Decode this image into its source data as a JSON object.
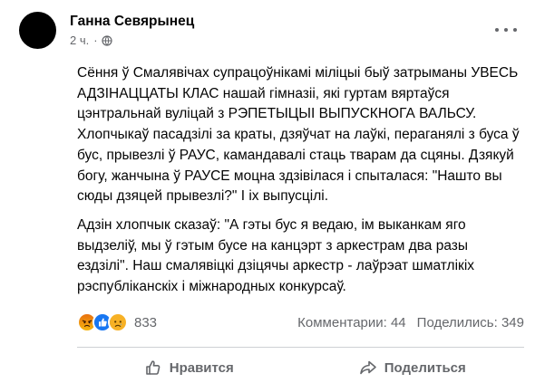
{
  "post": {
    "author": "Ганна Севярынец",
    "time": "2 ч.",
    "separator": "·",
    "privacy_icon": "globe-icon",
    "more_icon": "more-options-icon",
    "body": {
      "paragraph1": [
        "Сёння ў Смалявічах супрацоўнікамі міліцыі быў затрыманы УВЕСЬ",
        "АДЗІНАЦЦАТЫ КЛАС нашай гімназіі, які гуртам вяртаўся",
        "цэнтральнай вуліцай з РЭПЕТЫЦЫІ ВЫПУСКНОГА ВАЛЬСУ.",
        "Хлопчыкаў пасадзілі за краты, дзяўчат на лаўкі, пераганялі з буса ў",
        "бус, прывезлі ў РАУС, камандавалі стаць тварам да сцяны. Дзякуй",
        "богу, жанчына ў РАУСЕ моцна здзівілася і спыталася: \"Нашто вы",
        "сюды дзяцей прывезлі?\" І іх выпусцілі."
      ],
      "paragraph2": [
        "Адзін хлопчык сказаў: \"А гэты бус я ведаю, ім выканкам яго",
        "выдзеліў, мы ў гэтым бусе на канцэрт з аркестрам два разы",
        "ездзілі\". Наш смалявіцкі дзіцячы аркестр - лаўрэат шматлікіх",
        "рэспубліканскіх і міжнародных конкурсаў."
      ]
    },
    "reactions": {
      "icons": [
        "angry-reaction-icon",
        "like-reaction-icon",
        "sad-reaction-icon"
      ],
      "count": "833",
      "comments": "Комментарии: 44",
      "shares": "Поделились: 349"
    },
    "actions": {
      "like_label": "Нравится",
      "share_label": "Поделиться",
      "like_icon": "thumbs-up-icon",
      "share_icon": "share-arrow-icon"
    },
    "colors": {
      "text": "#050505",
      "secondary": "#65676b",
      "like_blue": "#1877f2",
      "angry_orange": "#e9710f",
      "sad_yellow": "#f7b125"
    }
  }
}
